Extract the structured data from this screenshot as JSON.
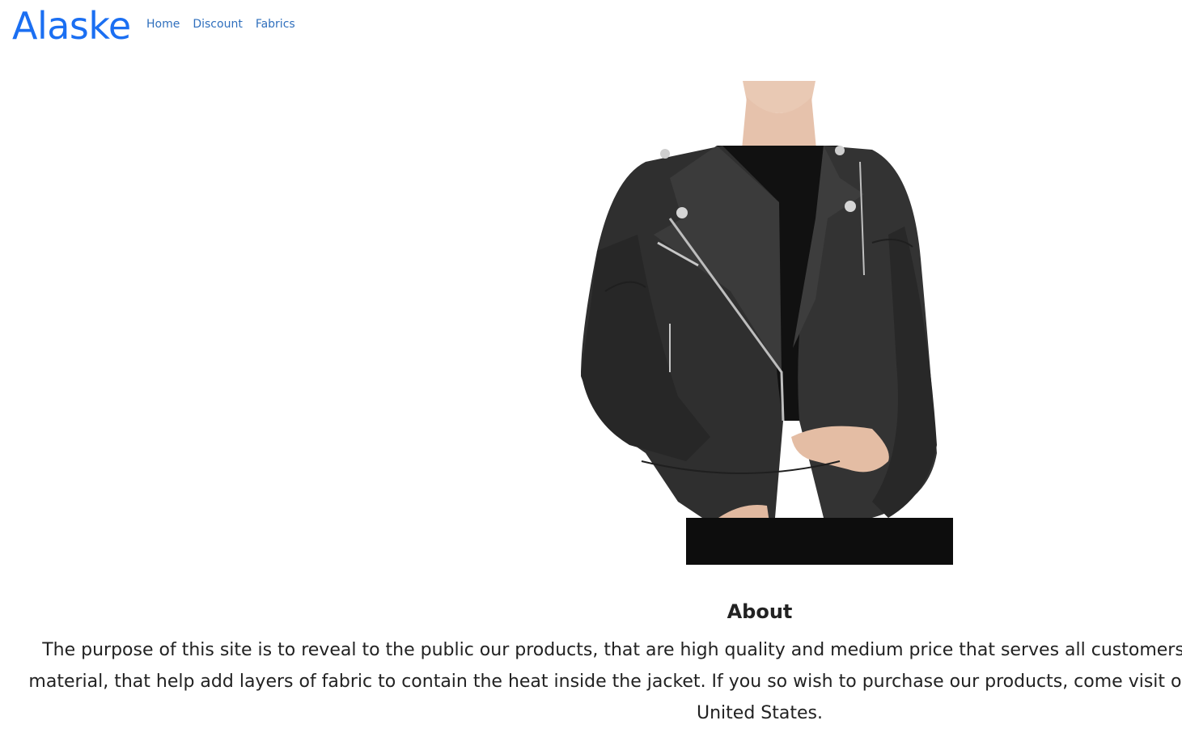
{
  "brand": "Alaske",
  "nav": {
    "home": "Home",
    "discount": "Discount",
    "fabrics": "Fabrics"
  },
  "hero": {
    "image": "woman-black-leather-jacket"
  },
  "about": {
    "title": "About",
    "text": "The purpose of this site is to reveal to the public our products, that are high quality and medium price that serves all customers. Our jackets contain animal safe material, that help add layers of fabric to contain the heat inside the jacket. If you so wish to purchase our products, come visit one of our stores located across the United States."
  },
  "colors": {
    "brand": "#1b6ff2",
    "link": "#2f6fbd",
    "text": "#222222"
  }
}
